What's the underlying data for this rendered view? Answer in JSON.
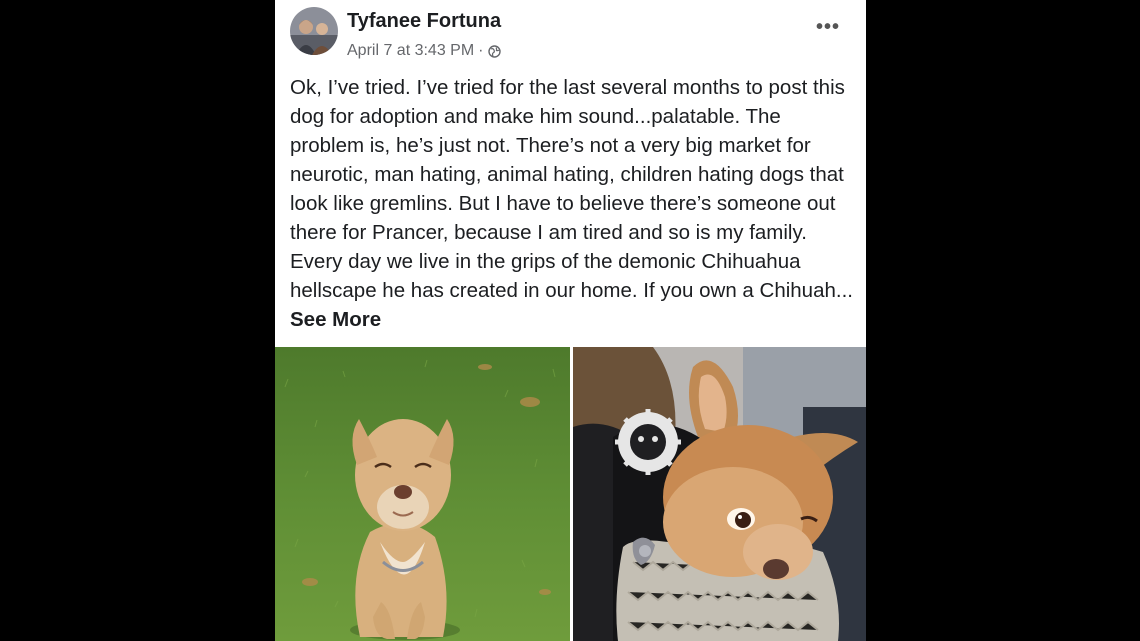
{
  "post": {
    "author": "Tyfanee Fortuna",
    "timestamp": "April 7 at 3:43 PM",
    "separator": "·",
    "audience_icon": "globe-icon",
    "more_icon": "more-options-icon",
    "more_label": "•••",
    "body_text": "Ok, I’ve tried. I’ve tried for the last several months to post this dog for adoption and make him sound...palatable. The problem is, he’s just not. There’s not a very big market for neurotic, man hating, animal hating, children hating dogs that look like gremlins. But I have to believe there’s someone out there for Prancer, because I am tired and so is my family. Every day we live in the grips of the demonic Chihuahua hellscape he has created in our home. If you own a Chihuah...",
    "see_more_label": "See More",
    "photos": [
      {
        "subject": "chihuahua-on-grass"
      },
      {
        "subject": "chihuahua-in-sweater"
      }
    ],
    "colors": {
      "text": "#1c1e21",
      "secondary_text": "#65676b",
      "background": "#ffffff",
      "letterbox": "#000000"
    }
  }
}
